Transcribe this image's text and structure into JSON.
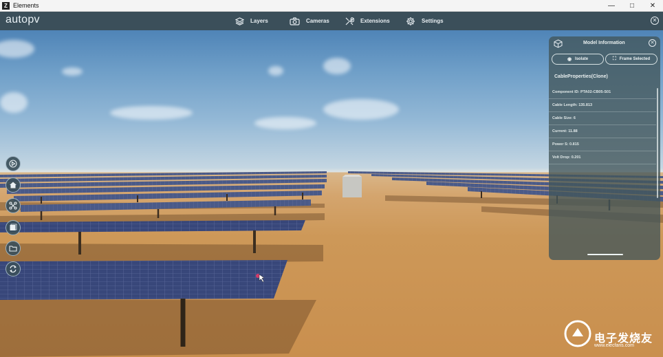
{
  "window": {
    "title": "Elements",
    "controls": [
      "minimize",
      "maximize",
      "close"
    ]
  },
  "appbar": {
    "logo": "autopv",
    "nav": [
      {
        "label": "Layers",
        "icon": "layers-icon"
      },
      {
        "label": "Cameras",
        "icon": "camera-icon"
      },
      {
        "label": "Extensions",
        "icon": "tools-icon"
      },
      {
        "label": "Settings",
        "icon": "gear-icon"
      }
    ]
  },
  "toolbar": {
    "items": [
      {
        "icon": "play-view-icon"
      },
      {
        "icon": "home-icon"
      },
      {
        "icon": "network-icon"
      },
      {
        "icon": "image-icon"
      },
      {
        "icon": "folder-icon"
      },
      {
        "icon": "refresh-icon"
      }
    ]
  },
  "panel": {
    "title": "Model Information",
    "isolate_label": "Isolate",
    "frame_label": "Frame Selected",
    "section": "CableProperties(Clone)",
    "properties": [
      "Component ID: PTA02-CB05-S01",
      "Cable Length: 135.813",
      "Cable Size: 6",
      "Current: 11.88",
      "Power S: 0.815",
      "Volt Drop: 0.201"
    ]
  },
  "watermark": {
    "text": "电子发烧友",
    "url": "www.elecfans.com"
  },
  "colors": {
    "appbar": "#3b4f5a",
    "panel": "#42565a",
    "sand": "#cd9858",
    "sky": "#6f9fc8",
    "solar_panel": "#3a4a7c"
  }
}
